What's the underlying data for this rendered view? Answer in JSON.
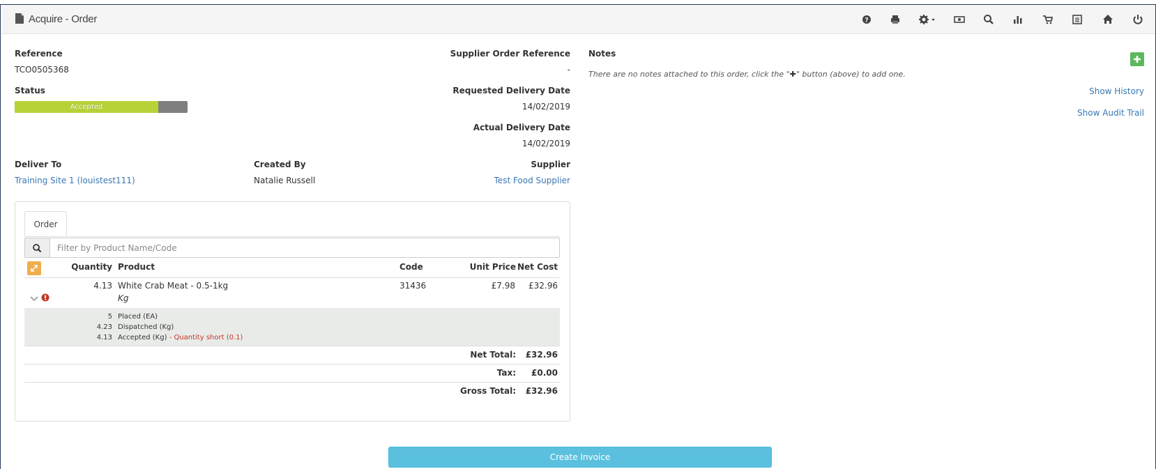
{
  "header": {
    "title": "Acquire - Order",
    "toolbar_icons": [
      "help-icon",
      "print-icon",
      "settings-icon",
      "cash-icon",
      "search-icon",
      "reports-icon",
      "cart-icon",
      "list-icon",
      "home-icon",
      "power-icon"
    ]
  },
  "order": {
    "reference_label": "Reference",
    "reference": "TCO0505368",
    "status_label": "Status",
    "status": "Accepted",
    "status_progress": 0.83,
    "supplier_ref_label": "Supplier Order Reference",
    "supplier_ref": "-",
    "requested_delivery_label": "Requested Delivery Date",
    "requested_delivery": "14/02/2019",
    "actual_delivery_label": "Actual Delivery Date",
    "actual_delivery": "14/02/2019",
    "deliver_to_label": "Deliver To",
    "deliver_to": "Training Site 1 (louistest111)",
    "created_by_label": "Created By",
    "created_by": "Natalie Russell",
    "supplier_label": "Supplier",
    "supplier": "Test Food Supplier"
  },
  "notes": {
    "title": "Notes",
    "empty_text_before": "There are no notes attached to this order, click the \"",
    "empty_text_after": "\" button (above) to add one.",
    "show_history": "Show History",
    "show_audit_trail": "Show Audit Trail"
  },
  "table": {
    "tab": "Order",
    "filter_placeholder": "Filter by Product Name/Code",
    "columns": {
      "quantity": "Quantity",
      "product": "Product",
      "code": "Code",
      "unit_price": "Unit Price",
      "net_cost": "Net Cost"
    },
    "rows": [
      {
        "quantity": "4.13",
        "product": "White Crab Meat - 0.5-1kg",
        "unit": "Kg",
        "code": "31436",
        "unit_price": "£7.98",
        "net_cost": "£32.96",
        "details": [
          {
            "qty": "5",
            "label": "Placed (EA)"
          },
          {
            "qty": "4.23",
            "label": "Dispatched (Kg)"
          },
          {
            "qty": "4.13",
            "label": "Accepted (Kg)",
            "warning_sep": " - ",
            "warning": "Quantity short (0.1)"
          }
        ]
      }
    ],
    "totals": {
      "net_label": "Net Total:",
      "net": "£32.96",
      "tax_label": "Tax:",
      "tax": "£0.00",
      "gross_label": "Gross Total:",
      "gross": "£32.96"
    }
  },
  "actions": {
    "create_invoice": "Create Invoice"
  },
  "colors": {
    "status_accepted": "#b7d237",
    "status_remaining": "#7f7f7f",
    "link": "#3a78b5",
    "primary_button": "#5bc0de",
    "add_button": "#5cb85c",
    "warning": "#c0392b"
  }
}
